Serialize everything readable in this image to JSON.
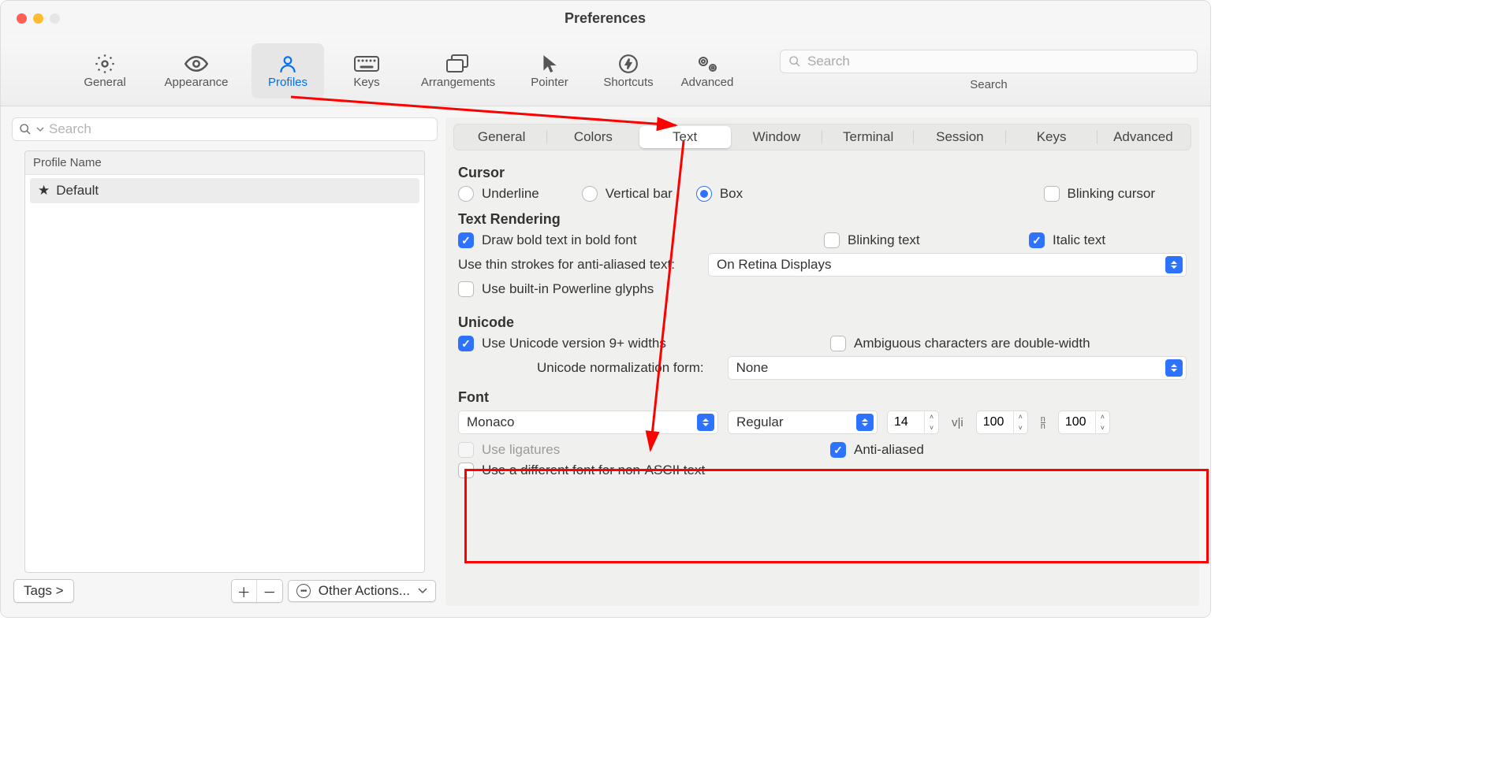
{
  "window": {
    "title": "Preferences"
  },
  "toolbar": {
    "tabs": [
      "General",
      "Appearance",
      "Profiles",
      "Keys",
      "Arrangements",
      "Pointer",
      "Shortcuts",
      "Advanced"
    ],
    "active": "Profiles",
    "search_placeholder": "Search",
    "search_label": "Search"
  },
  "sidebar": {
    "search_placeholder": "Search",
    "header": "Profile Name",
    "profiles": [
      {
        "name": "Default",
        "starred": true
      }
    ],
    "tags_label": "Tags >",
    "other_actions_label": "Other Actions..."
  },
  "subtabs": {
    "items": [
      "General",
      "Colors",
      "Text",
      "Window",
      "Terminal",
      "Session",
      "Keys",
      "Advanced"
    ],
    "active": "Text"
  },
  "sections": {
    "cursor": {
      "title": "Cursor",
      "underline": "Underline",
      "vertical": "Vertical bar",
      "box": "Box",
      "blinking": "Blinking cursor"
    },
    "text_rendering": {
      "title": "Text Rendering",
      "draw_bold": "Draw bold text in bold font",
      "blinking_text": "Blinking text",
      "italic_text": "Italic text",
      "thin_strokes_label": "Use thin strokes for anti-aliased text:",
      "thin_strokes_value": "On Retina Displays",
      "powerline": "Use built-in Powerline glyphs"
    },
    "unicode": {
      "title": "Unicode",
      "v9": "Use Unicode version 9+ widths",
      "ambiguous": "Ambiguous characters are double-width",
      "norm_label": "Unicode normalization form:",
      "norm_value": "None"
    },
    "font": {
      "title": "Font",
      "family": "Monaco",
      "weight": "Regular",
      "size": "14",
      "hspace": "100",
      "vspace": "100",
      "ligatures": "Use ligatures",
      "antialiased": "Anti-aliased",
      "nonascii": "Use a different font for non-ASCII text"
    }
  }
}
